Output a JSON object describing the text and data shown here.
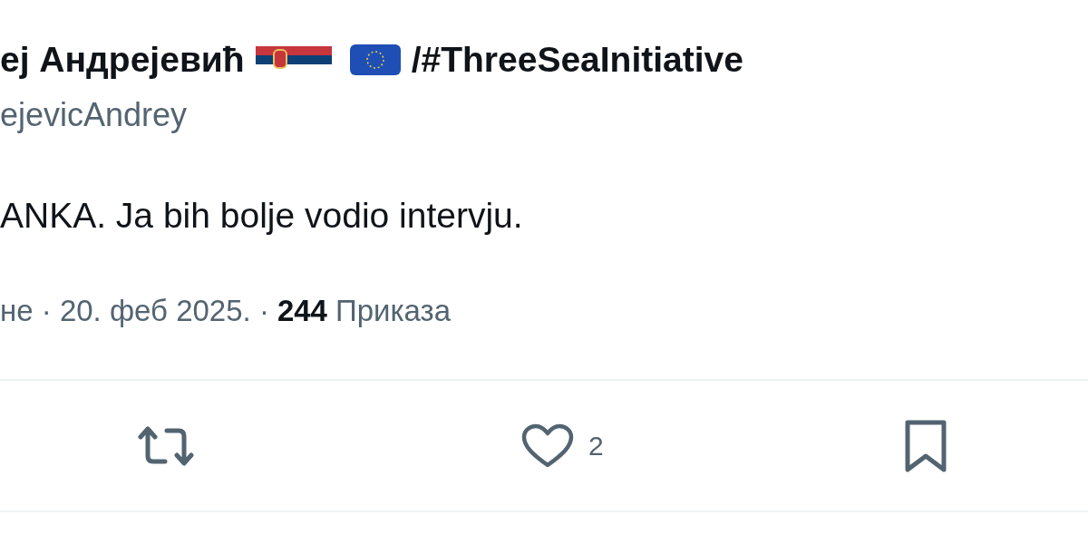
{
  "author": {
    "name": "ej Андрејевић",
    "flags": [
      {
        "kind": "serbia"
      },
      {
        "kind": "eu"
      }
    ],
    "name_suffix": "/#ThreeSeaInitiative",
    "handle": "ejevicAndrey"
  },
  "text": "ANKA. Ja bih bolje vodio intervju.",
  "meta": {
    "date_text": "не · 20. феб 2025. ·",
    "views_count": "244",
    "views_label": "Приказа"
  },
  "actions": [
    {
      "kind": "retweet"
    },
    {
      "kind": "like",
      "count": "2"
    },
    {
      "kind": "bookmark"
    }
  ]
}
